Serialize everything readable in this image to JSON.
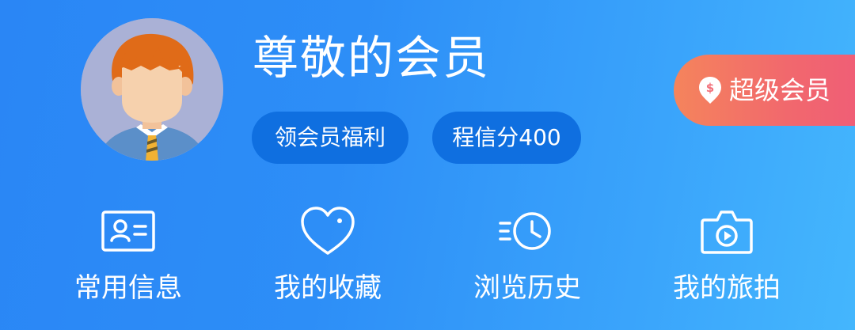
{
  "profile": {
    "username": "尊敬的会员",
    "avatar_icon": "cartoon-boy-avatar",
    "chips": [
      {
        "label": "领会员福利"
      },
      {
        "label": "程信分400"
      }
    ]
  },
  "vip_badge": {
    "label": "超级会员",
    "icon": "coin-pin-icon"
  },
  "quick_links": [
    {
      "label": "常用信息",
      "icon": "id-card-icon"
    },
    {
      "label": "我的收藏",
      "icon": "heart-icon"
    },
    {
      "label": "浏览历史",
      "icon": "history-clock-icon"
    },
    {
      "label": "我的旅拍",
      "icon": "camera-icon"
    }
  ],
  "colors": {
    "background_start": "#2a86f5",
    "background_end": "#44b6fd",
    "chip_background": "#0f6fe0",
    "vip_start": "#f5845c",
    "vip_end": "#f05d77",
    "text": "#ffffff"
  }
}
